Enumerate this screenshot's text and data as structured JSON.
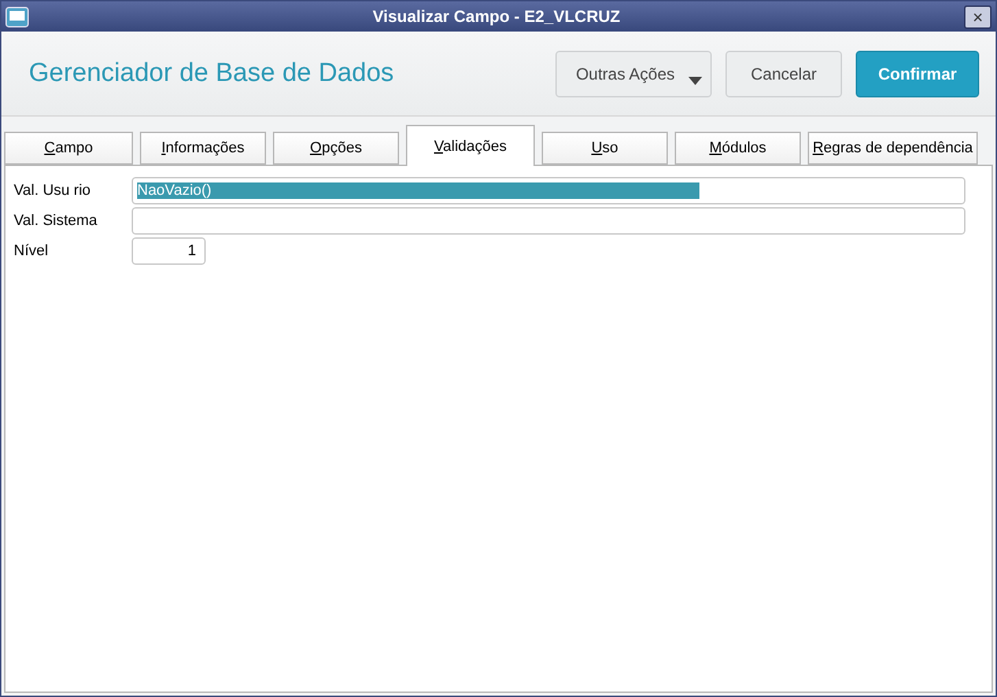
{
  "window": {
    "title": "Visualizar Campo - E2_VLCRUZ",
    "close": "×"
  },
  "header": {
    "title": "Gerenciador de Base de Dados",
    "buttons": [
      {
        "label": "Outras Ações",
        "kind": "menu"
      },
      {
        "label": "Cancelar",
        "kind": "plain"
      },
      {
        "label": "Confirmar",
        "kind": "primary"
      }
    ]
  },
  "tabs": [
    {
      "label": "Campo",
      "selected": false
    },
    {
      "label": "Informações",
      "selected": false
    },
    {
      "label": "Opções",
      "selected": false
    },
    {
      "label": "Validações",
      "selected": true
    },
    {
      "label": "Uso",
      "selected": false
    },
    {
      "label": "Módulos",
      "selected": false
    },
    {
      "label": "Regras de dependência",
      "selected": false
    }
  ],
  "fields": [
    {
      "label": "Val. Usu rio",
      "value": "NaoVazio()",
      "highlighted": true,
      "kind": "text"
    },
    {
      "label": "Val. Sistema",
      "kind": "text"
    },
    {
      "label": "Nível",
      "value": "1",
      "highlighted": false,
      "kind": "number"
    }
  ]
}
